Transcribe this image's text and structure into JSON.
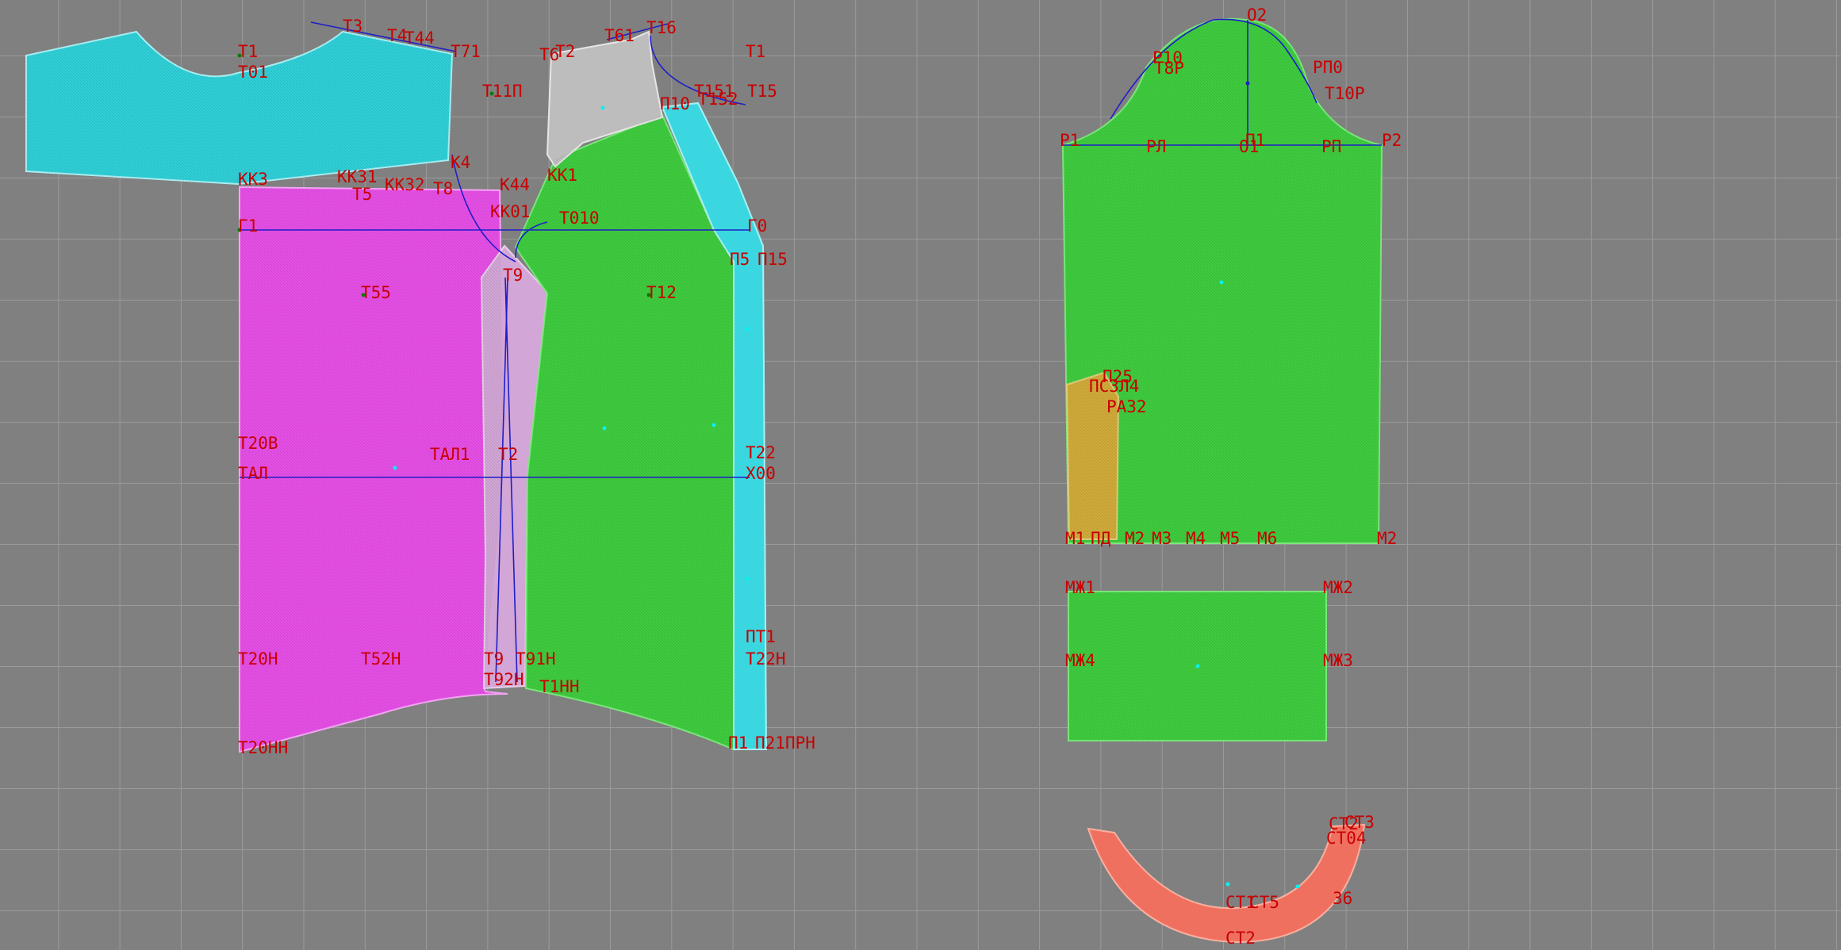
{
  "colors": {
    "background": "#808080",
    "grid": "#9a9a9a",
    "label": "#c80000",
    "yoke": "#2fd0d8",
    "back": "#e64fe6",
    "side": "#d2a6d6",
    "front": "#3fcc3f",
    "placket": "#3ad7e0",
    "shoulder": "#bdbdbd",
    "sleeve": "#3fcc3f",
    "sleeve_slit": "#e0a83a",
    "cuff": "#3fcc3f",
    "collar": "#f07060",
    "construction_line": "#1e1ec8"
  },
  "pieces": {
    "yoke": "yoke",
    "back": "back",
    "side": "side",
    "front": "front",
    "placket": "placket",
    "shoulder": "shoulder",
    "sleeve": "sleeve",
    "sleeve_slit": "sleeve-slit",
    "cuff": "cuff",
    "collar": "collar"
  },
  "labels": [
    "Т3",
    "Т1",
    "Т44",
    "Т4",
    "Т71",
    "Т01",
    "Т11П",
    "Т6",
    "Т2",
    "Т61",
    "Т16",
    "Т1",
    "Т15",
    "Т151",
    "Т152",
    "П10",
    "К4",
    "КК3",
    "КК31",
    "КК32",
    "Т5",
    "Т8",
    "К44",
    "КК1",
    "КК01",
    "Т010",
    "Г1",
    "Г0",
    "П5",
    "П15",
    "Т9",
    "Т55",
    "Т12",
    "Т20В",
    "ТАЛ",
    "ТАЛ1",
    "Т2",
    "Т22",
    "Х00",
    "Т20Н",
    "Т52Н",
    "Т9",
    "Т91Н",
    "Т92Н",
    "Т1НН",
    "ПТ1",
    "Т22Н",
    "Т20НН",
    "П1",
    "П21",
    "ПРН",
    "О2",
    "Р10",
    "Т8Р",
    "РП0",
    "Т10Р",
    "Р1",
    "РЛ",
    "П1",
    "О1",
    "РП",
    "Р2",
    "П25",
    "ПСЗЛ4",
    "РА32",
    "М1",
    "ПД",
    "М2",
    "М3",
    "М4",
    "М5",
    "М6",
    "М2",
    "МЖ1",
    "МЖ2",
    "МЖ4",
    "МЖ3",
    "СТ2",
    "СТ3",
    "СТ04",
    "36",
    "СТ5",
    "СТ1",
    "СТ2"
  ]
}
